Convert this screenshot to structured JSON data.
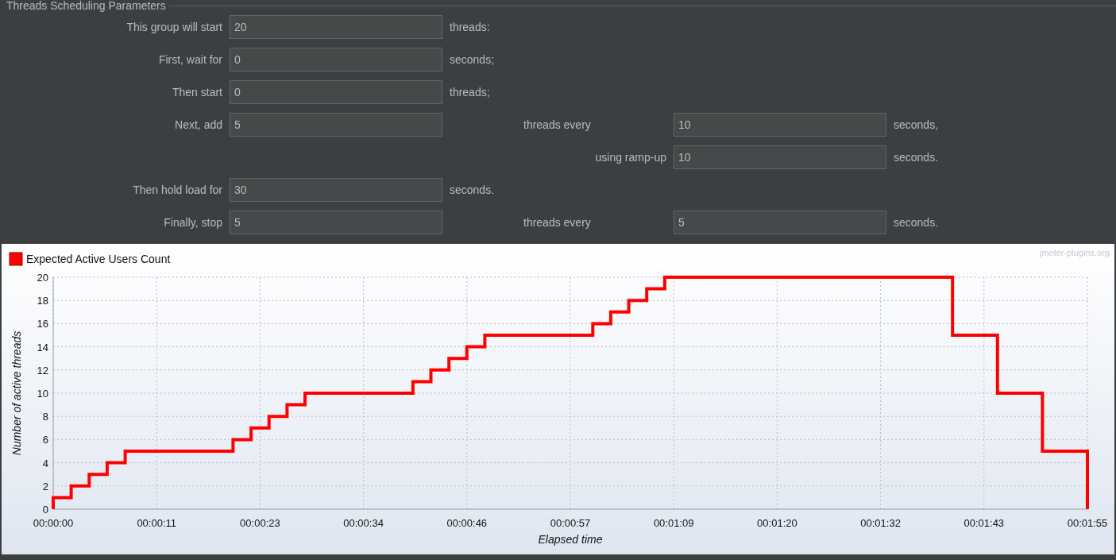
{
  "panel": {
    "title": "Threads Scheduling Parameters",
    "rows": [
      {
        "kind": "single",
        "label": "This group will start",
        "value": "20",
        "unit": "threads:"
      },
      {
        "kind": "single",
        "label": "First, wait for",
        "value": "0",
        "unit": "seconds;"
      },
      {
        "kind": "single",
        "label": "Then start",
        "value": "0",
        "unit": "threads;"
      },
      {
        "kind": "double",
        "label": "Next, add",
        "value": "5",
        "mid_label": "threads every",
        "value2": "10",
        "unit2": "seconds,"
      },
      {
        "kind": "ramp",
        "mid_label": "using ramp-up",
        "value2": "10",
        "unit2": "seconds."
      },
      {
        "kind": "single",
        "label": "Then hold load for",
        "value": "30",
        "unit": "seconds."
      },
      {
        "kind": "double",
        "label": "Finally, stop",
        "value": "5",
        "mid_label": "threads every",
        "value2": "5",
        "unit2": "seconds."
      }
    ]
  },
  "chart_panel": {
    "watermark": "jmeter-plugins.org",
    "chart_data": {
      "type": "line",
      "xlabel": "Elapsed time",
      "ylabel": "Number of active threads",
      "x": [
        0,
        0,
        2,
        2,
        4,
        4,
        6,
        6,
        8,
        8,
        20,
        20,
        22,
        22,
        24,
        24,
        26,
        26,
        28,
        28,
        40,
        40,
        42,
        42,
        44,
        44,
        46,
        46,
        48,
        48,
        60,
        60,
        62,
        62,
        64,
        64,
        66,
        66,
        68,
        68,
        100,
        100,
        105,
        105,
        110,
        110,
        115,
        115
      ],
      "series": [
        {
          "name": "Expected Active Users Count",
          "color": "#ff0000",
          "values": [
            0,
            1,
            1,
            2,
            2,
            3,
            3,
            4,
            4,
            5,
            5,
            6,
            6,
            7,
            7,
            8,
            8,
            9,
            9,
            10,
            10,
            11,
            11,
            12,
            12,
            13,
            13,
            14,
            14,
            15,
            15,
            16,
            16,
            17,
            17,
            18,
            18,
            19,
            19,
            20,
            20,
            15,
            15,
            10,
            10,
            5,
            5,
            0
          ]
        }
      ],
      "grid": true,
      "xlim": [
        0,
        115
      ],
      "ylim": [
        0,
        20
      ],
      "xticks": [
        {
          "value": 0,
          "label": "00:00:00"
        },
        {
          "value": 11.5,
          "label": "00:00:11"
        },
        {
          "value": 23,
          "label": "00:00:23"
        },
        {
          "value": 34.5,
          "label": "00:00:34"
        },
        {
          "value": 46,
          "label": "00:00:46"
        },
        {
          "value": 57.5,
          "label": "00:00:57"
        },
        {
          "value": 69,
          "label": "00:01:09"
        },
        {
          "value": 80.5,
          "label": "00:01:20"
        },
        {
          "value": 92,
          "label": "00:01:32"
        },
        {
          "value": 103.5,
          "label": "00:01:43"
        },
        {
          "value": 115,
          "label": "00:01:55"
        }
      ],
      "yticks": [
        0,
        2,
        4,
        6,
        8,
        10,
        12,
        14,
        16,
        18,
        20
      ]
    }
  }
}
